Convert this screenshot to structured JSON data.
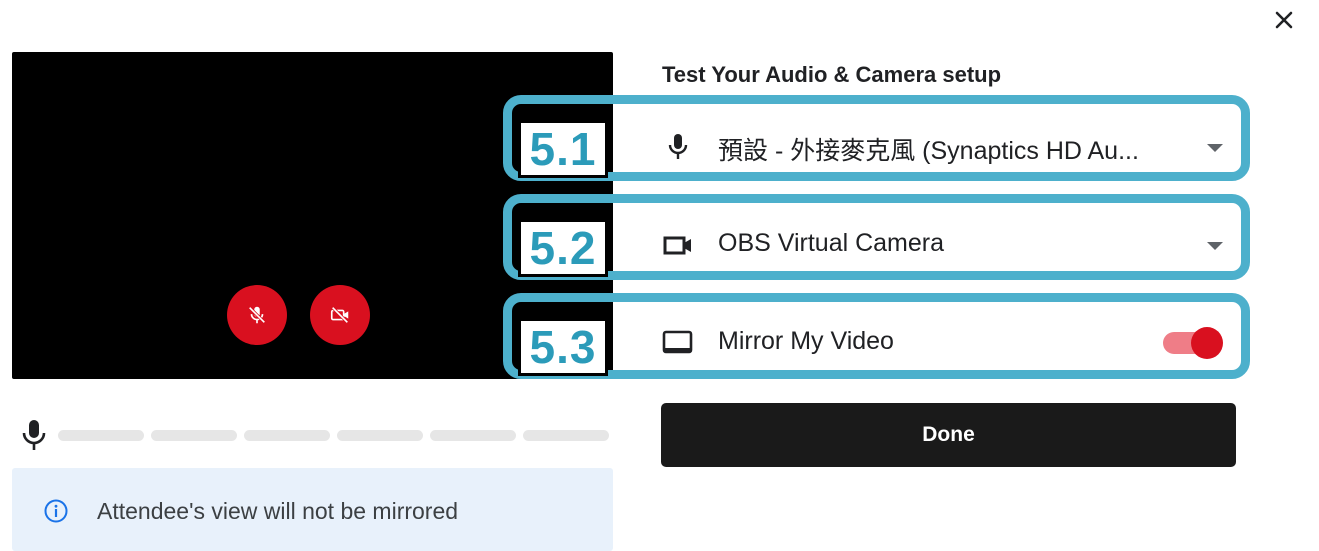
{
  "dialog": {
    "title": "Test Your Audio & Camera setup",
    "close_icon": "close-icon"
  },
  "preview": {
    "mic_button_icon": "mic-off-icon",
    "camera_button_icon": "video-off-icon",
    "button_color": "#d9101f",
    "audio_level_segments": 6
  },
  "info_banner": {
    "icon": "info-icon",
    "text": "Attendee's view will not be mirrored",
    "background": "#e8f1fb"
  },
  "microphone": {
    "icon": "mic-icon",
    "selected": "預設 - 外接麥克風 (Synaptics HD Au..."
  },
  "camera": {
    "icon": "videocam-icon",
    "selected": "OBS Virtual Camera"
  },
  "mirror": {
    "icon": "monitor-icon",
    "label": "Mirror My Video",
    "enabled": true
  },
  "done_button": {
    "label": "Done"
  },
  "annotations": [
    {
      "tag": "5.1",
      "color": "#4db0cc"
    },
    {
      "tag": "5.2",
      "color": "#4db0cc"
    },
    {
      "tag": "5.3",
      "color": "#4db0cc"
    }
  ]
}
